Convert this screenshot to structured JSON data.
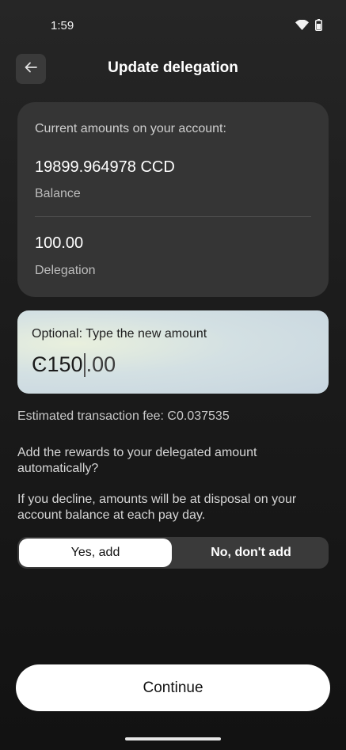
{
  "status_bar": {
    "time": "1:59",
    "wifi_icon": "wifi-icon",
    "battery_icon": "battery-icon"
  },
  "header": {
    "title": "Update delegation",
    "back_icon": "arrow-left-icon"
  },
  "amounts_card": {
    "heading": "Current amounts on your account:",
    "balance_value": "19899.964978 CCD",
    "balance_label": "Balance",
    "delegation_value": "100.00",
    "delegation_label": "Delegation"
  },
  "amount_input": {
    "label": "Optional: Type the new amount",
    "currency_symbol": "Ͼ",
    "typed_value": "150",
    "remaining_value": ".00"
  },
  "fee": {
    "text": "Estimated transaction fee: Ͼ0.037535"
  },
  "rewards": {
    "question": "Add the rewards to your delegated amount automatically?",
    "decline_note": "If you decline, amounts will be at disposal on your account balance at each pay day.",
    "yes_label": "Yes, add",
    "no_label": "No, don't add",
    "selected": "yes"
  },
  "footer": {
    "continue_label": "Continue"
  },
  "colors": {
    "background": "#1d1d1d",
    "card": "#353535",
    "input_gradient": "#d3e0e3",
    "button": "#ffffff"
  }
}
